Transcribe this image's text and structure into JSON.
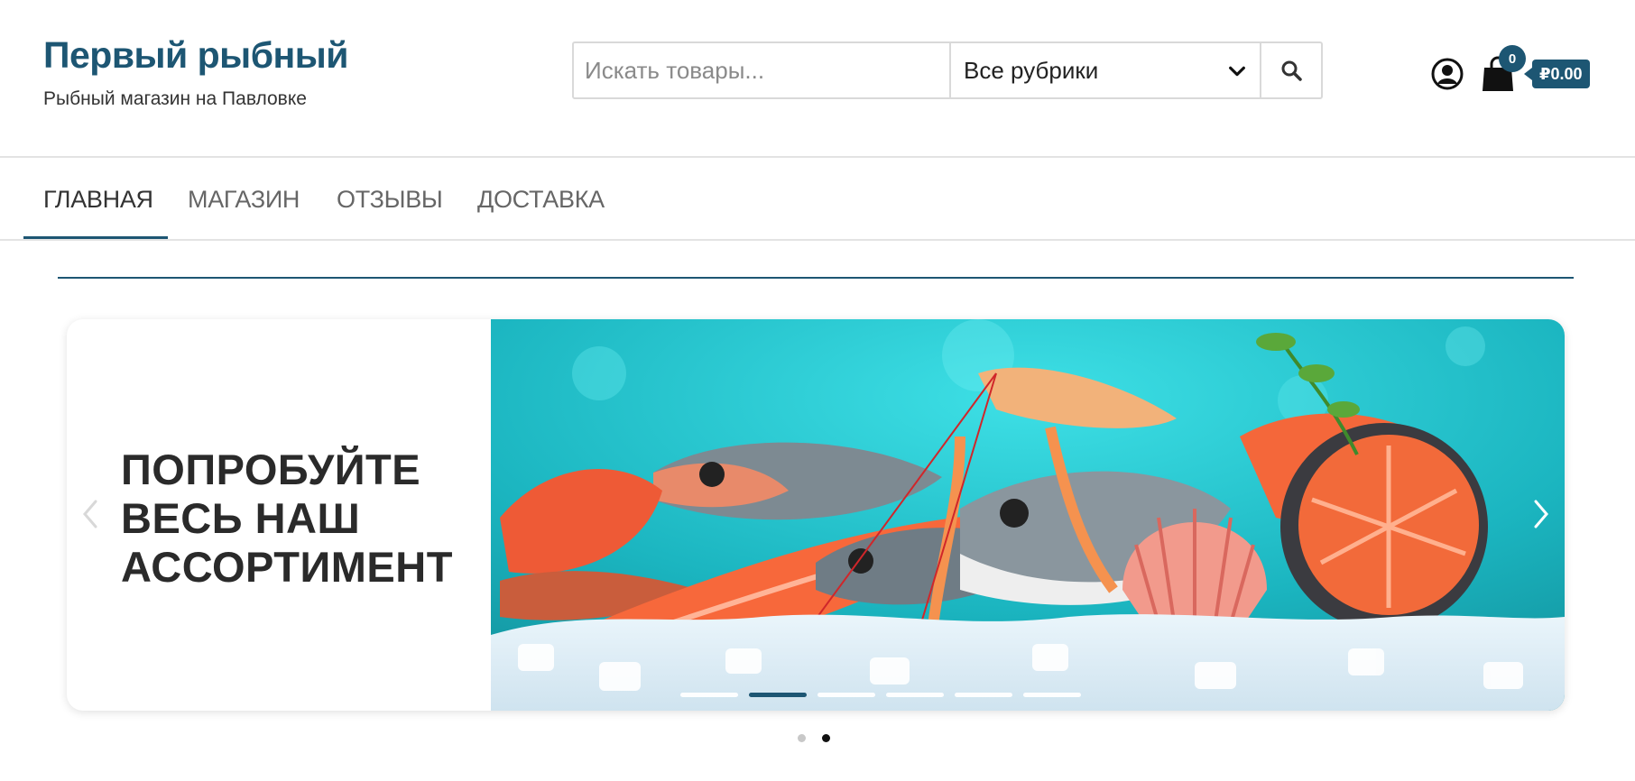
{
  "header": {
    "site_title": "Первый рыбный",
    "tagline": "Рыбный магазин на Павловке",
    "search": {
      "placeholder": "Искать товары...",
      "value": "",
      "category_selected": "Все рубрики",
      "search_icon": "search-icon"
    },
    "account_icon": "user-circle-icon",
    "cart": {
      "icon": "shopping-bag-icon",
      "count": "0",
      "total": "₽0.00"
    }
  },
  "nav": {
    "items": [
      {
        "label": "ГЛАВНАЯ",
        "active": true
      },
      {
        "label": "МАГАЗИН",
        "active": false
      },
      {
        "label": "ОТЗЫВЫ",
        "active": false
      },
      {
        "label": "ДОСТАВКА",
        "active": false
      }
    ]
  },
  "slider": {
    "heading_lines": [
      "ПОПРОБУЙТЕ",
      "ВЕСЬ НАШ",
      "АССОРТИМЕНТ"
    ],
    "image": "seafood-assortment-on-ice",
    "inner_indicator_count": 6,
    "inner_active_index": 1,
    "dot_count": 2,
    "dot_active_index": 1
  },
  "colors": {
    "brand": "#1d5673",
    "text": "#333333",
    "nav_inactive": "#666666",
    "border": "#e3e3e3"
  }
}
